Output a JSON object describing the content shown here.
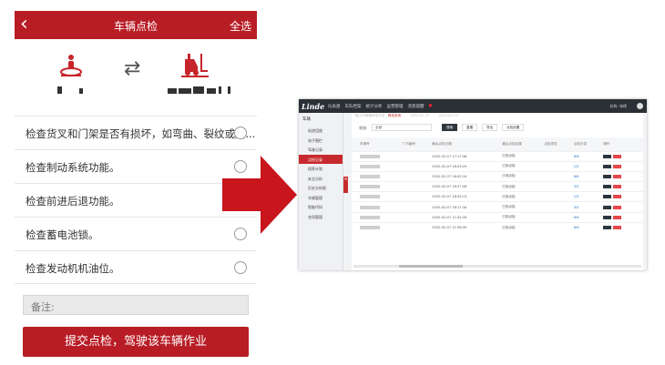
{
  "phone": {
    "header": {
      "back_icon": "chevron-left-icon",
      "title": "车辆点检",
      "select_all": "全选"
    },
    "accent_color": "#b81d26",
    "check_items": [
      {
        "text": "检查货叉和门架是否有损坏，如弯曲、裂纹或磨..."
      },
      {
        "text": "检查制动系统功能。"
      },
      {
        "text": "检查前进后退功能。"
      },
      {
        "text": "检查蓄电池锁。"
      },
      {
        "text": "检查发动机机油位。"
      }
    ],
    "note_placeholder": "备注:",
    "submit_label": "提交点检，驾驶该车辆作业"
  },
  "desktop": {
    "logo": "Linde",
    "nav": [
      "仪表盘",
      "车队档案",
      "统计分析",
      "运营管理",
      "消息提醒"
    ],
    "user": "机构: 林德",
    "search_placeholder": "输入车辆编号或车型",
    "search_label": "筛选查询",
    "search_dates": [
      "2020-02-07",
      "2020-02-13"
    ],
    "sidebar_title": "车辆",
    "sidebar_items": [
      "轨迹回放",
      "电子围栏",
      "驾驶记录",
      "点检记录",
      "保养计划",
      "安全分析",
      "历史分析报",
      "车辆管理",
      "智能代码",
      "合同管理"
    ],
    "sidebar_active_index": 3,
    "collapse_tab": "☰",
    "filter": {
      "label": "状态:",
      "value": "全部",
      "search_btn": "搜索",
      "reset_btn": "重置",
      "export_btn": "导出",
      "settings_btn": "点检设置"
    },
    "table": {
      "headers": [
        "车辆号",
        "厂内编号",
        "最后点检日期",
        "最后点检结果",
        "点检项目",
        "点检记录",
        "操作"
      ],
      "rows": [
        {
          "date": "2020-02-07 17:17:46",
          "result": "已到点检",
          "link": "6/6"
        },
        {
          "date": "2020-02-07 16:43:25",
          "result": "已到点检",
          "link": "1/5"
        },
        {
          "date": "2020-02-07 16:42:14",
          "result": "已到点检",
          "link": "6/6"
        },
        {
          "date": "2020-02-07 16:37:08",
          "result": "已到点检",
          "link": "3/5"
        },
        {
          "date": "2020-02-07 16:34:13",
          "result": "已到点检",
          "link": "1/5"
        },
        {
          "date": "2020-02-07 16:17:34",
          "result": "已到点检",
          "link": "3/5"
        },
        {
          "date": "2020-02-07 11:42:34",
          "result": "已到点检",
          "link": "6/6"
        },
        {
          "date": "2020-02-07 11:36:35",
          "result": "已到点检",
          "link": "6/6"
        }
      ]
    }
  }
}
